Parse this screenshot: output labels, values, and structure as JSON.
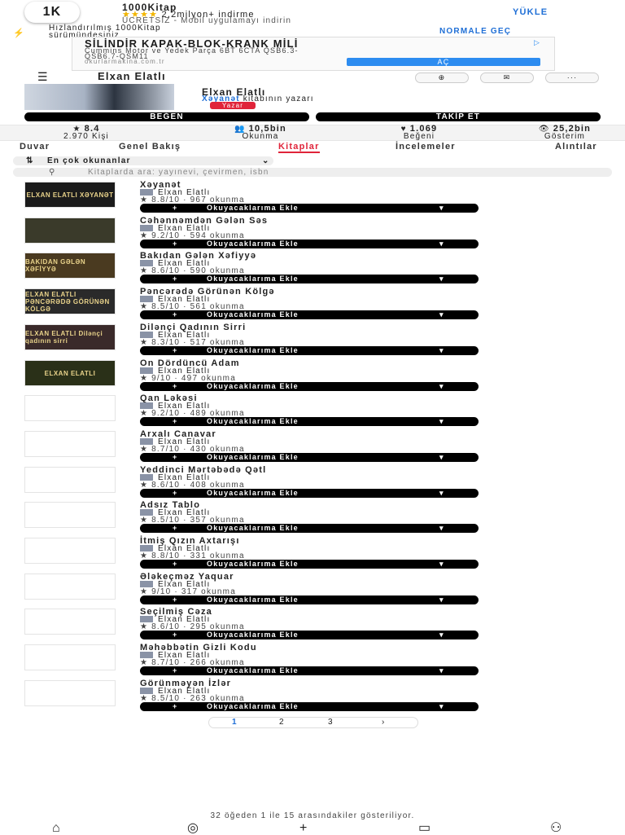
{
  "app_banner": {
    "logo": "1K",
    "app_name": "1000Kitap",
    "rating_stars": "★★★★",
    "downloads": "2,2milyon+ indirme",
    "subtitle": "ÜCRETSİZ - Mobil uygulamayı indirin",
    "install_label": "YÜKLE"
  },
  "accelerated_notice": {
    "text_line1": "Hızlandırılmış 1000Kitap",
    "text_line2": "sürümündesiniz",
    "switch_label": "NORMALE GEÇ"
  },
  "ad": {
    "title": "SİLİNDİR KAPAK-BLOK-KRANK MİLİ",
    "line1": "Cummins Motor ve Yedek Parça 6BT 6CTA QSB6.3-",
    "line2": "QSB6.7-QSM11",
    "domain": "okurlarmakina.com.tr",
    "cta": "AÇ"
  },
  "header": {
    "author_name": "Elxan Elatlı"
  },
  "profile": {
    "name": "Elxan Elatlı",
    "book_link": "Xəyanət",
    "book_suffix": " kitabının yazarı",
    "tag": "Yazar",
    "like_label": "BEĞEN",
    "follow_label": "TAKİP ET"
  },
  "stats": [
    {
      "icon": "star-icon",
      "value": "8.4",
      "label": "2.970 Kişi"
    },
    {
      "icon": "readers-icon",
      "value": "10,5bin",
      "label": "Okunma"
    },
    {
      "icon": "heart-icon",
      "value": "1.069",
      "label": "Beğeni"
    },
    {
      "icon": "eye-icon",
      "value": "25,2bin",
      "label": "Gösterim"
    }
  ],
  "tabs": [
    "Duvar",
    "Genel Bakış",
    "Kitaplar",
    "İncelemeler",
    "Alıntılar"
  ],
  "active_tab": "Kitaplar",
  "sort_label": "En çok okunanlar",
  "search_placeholder": "Kitaplarda ara: yayınevi, çevirmen, isbn",
  "add_button_label": "Okuyacaklarıma Ekle",
  "books": [
    {
      "title": "Xəyanət",
      "author": "Elxan Elatlı",
      "rating": "8.8/10",
      "reads": "967 okunma",
      "cover": "ELXAN ELATLI XƏYANƏT"
    },
    {
      "title": "Cəhənnəmdən Gələn Səs",
      "author": "Elxan Elatlı",
      "rating": "9.2/10",
      "reads": "594 okunma",
      "cover": ""
    },
    {
      "title": "Bakıdan Gələn Xəfiyyə",
      "author": "Elxan Elatlı",
      "rating": "8.6/10",
      "reads": "590 okunma",
      "cover": "BAKIDAN GƏLƏN XƏFİYYƏ"
    },
    {
      "title": "Pəncərədə Görünən Kölgə",
      "author": "Elxan Elatlı",
      "rating": "8.5/10",
      "reads": "561 okunma",
      "cover": "ELXAN ELATLI PƏNCƏRƏDƏ GÖRÜNƏN KÖLGƏ"
    },
    {
      "title": "Dilənçi Qadının Sirri",
      "author": "Elxan Elatlı",
      "rating": "8.3/10",
      "reads": "517 okunma",
      "cover": "ELXAN ELATLI Dilənçi qadının sirri"
    },
    {
      "title": "On Dördüncü Adam",
      "author": "Elxan Elatlı",
      "rating": "9/10",
      "reads": "497 okunma",
      "cover": "ELXAN ELATLI"
    },
    {
      "title": "Qan Ləkəsi",
      "author": "Elxan Elatlı",
      "rating": "9.2/10",
      "reads": "489 okunma",
      "cover": ""
    },
    {
      "title": "Arxalı Canavar",
      "author": "Elxan Elatlı",
      "rating": "8.7/10",
      "reads": "430 okunma",
      "cover": ""
    },
    {
      "title": "Yeddinci Mərtəbədə Qətl",
      "author": "Elxan Elatlı",
      "rating": "8.6/10",
      "reads": "408 okunma",
      "cover": ""
    },
    {
      "title": "Adsız Tablo",
      "author": "Elxan Elatlı",
      "rating": "8.5/10",
      "reads": "357 okunma",
      "cover": ""
    },
    {
      "title": "İtmiş Qızın Axtarışı",
      "author": "Elxan Elatlı",
      "rating": "8.8/10",
      "reads": "331 okunma",
      "cover": ""
    },
    {
      "title": "Ələkeçməz Yaquar",
      "author": "Elxan Elatlı",
      "rating": "9/10",
      "reads": "317 okunma",
      "cover": ""
    },
    {
      "title": "Seçilmiş Cəza",
      "author": "Elxan Elatlı",
      "rating": "8.6/10",
      "reads": "295 okunma",
      "cover": ""
    },
    {
      "title": "Məhəbbətin Gizli Kodu",
      "author": "Elxan Elatlı",
      "rating": "8.7/10",
      "reads": "266 okunma",
      "cover": ""
    },
    {
      "title": "Görünməyən İzlər",
      "author": "Elxan Elatlı",
      "rating": "8.5/10",
      "reads": "263 okunma",
      "cover": ""
    }
  ],
  "pagination": {
    "pages": [
      "1",
      "2",
      "3"
    ],
    "next": "›",
    "current": "1"
  },
  "footer_info": "32 öğeden 1 ile 15 arasındakiler gösteriliyor.",
  "bottom_nav": [
    "home-icon",
    "explore-icon",
    "add-icon",
    "messages-icon",
    "profile-icon"
  ],
  "colors": {
    "accent": "#e0243a",
    "link": "#1f6fd6",
    "cta": "#2d8cf0"
  }
}
